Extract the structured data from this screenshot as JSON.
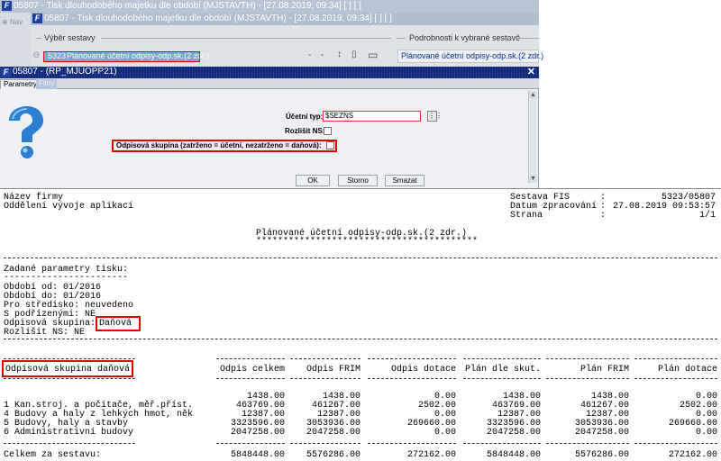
{
  "background": {
    "win1_title": "05807 - Tisk dlouhodobého majetku dle období (MJSTAVTH) - [27.08.2019; 09:34]  [ ]  [ ]",
    "nav_label": "Nav",
    "win2_title": "05807 - Tisk dlouhodobého majetku dle období (MJSTAVTH) - [27.08.2019; 09:34]  [ ]  [ ]",
    "group_left": "Výběr sestavy",
    "group_right": "Podrobnosti k vybrané sestavě",
    "selected_code": "5323",
    "selected_name": "Plánované účetní odpisy-odp.sk.(2 zdr.)",
    "detail_text": "Plánované účetní odpisy-odp.sk.(2 zdr.)",
    "toolbar_icons": [
      "minus-icon",
      "minus-icon",
      "sort-icon",
      "document-icon",
      "monitor-icon"
    ]
  },
  "dialog": {
    "title": "05807 - (RP_MJUOPP21)",
    "close": "✕",
    "tabs": [
      "Parametry",
      "Filtry"
    ],
    "ucetni_typ_label": "Účetní typ:",
    "ucetni_typ_value": "$SEZNS",
    "rozlisit_ns_label": "Rozlišit NS:",
    "odpisova_label": "Odpisová skupina (zatrženo = účetní, nezatrženo = daňová):",
    "buttons": {
      "ok": "OK",
      "storno": "Storno",
      "smazat": "Smazat"
    }
  },
  "report": {
    "company": "Název firmy",
    "department": "Oddělení vývoje aplikací",
    "meta_labels": [
      "Sestava FIS",
      "Datum zpracování",
      "Strana"
    ],
    "meta_values": [
      "5323/05807",
      "27.08.2019 09:53:57",
      "1/1"
    ],
    "title": "Plánované účetní odpisy-odp.sk.(2 zdr.)",
    "title_stars": "*****************************************",
    "params_heading": "Zadané parametry tisku:",
    "params_rule": "-----------------------",
    "params": {
      "obdobi_od": "Období od: 01/2016",
      "obdobi_do": "Období do: 01/2016",
      "stredisko": "Pro středisko: neuvedeno",
      "podrizene": "S podřízenými: NE",
      "skupina_label": "Odpisová skupina:",
      "skupina_value": "Daňová",
      "rozlisit": "Rozlišit NS: NE"
    },
    "columns": [
      "Odpisová skupina daňová",
      "Odpis celkem",
      "Odpis FRIM",
      "Odpis dotace",
      "Plán dle skut.",
      "Plán FRIM",
      "Plán dotace"
    ],
    "rows": [
      {
        "name": "",
        "values": [
          "1438.00",
          "1438.00",
          "0.00",
          "1438.00",
          "1438.00",
          "0.00"
        ]
      },
      {
        "name": "1 Kan.stroj. a počítače, měř.příst.",
        "values": [
          "463769.00",
          "461267.00",
          "2502.00",
          "463769.00",
          "461267.00",
          "2502.00"
        ]
      },
      {
        "name": "4 Budovy a haly z lehkých hmot, něk",
        "values": [
          "12387.00",
          "12387.00",
          "0.00",
          "12387.00",
          "12387.00",
          "0.00"
        ]
      },
      {
        "name": "5 Budovy, haly a stavby",
        "values": [
          "3323596.00",
          "3053936.00",
          "269660.00",
          "3323596.00",
          "3053936.00",
          "269660.00"
        ]
      },
      {
        "name": "6 Administrativní budovy",
        "values": [
          "2047258.00",
          "2047258.00",
          "0.00",
          "2047258.00",
          "2047258.00",
          "0.00"
        ]
      }
    ],
    "total_label": "Celkem za sestavu:",
    "totals": [
      "5848448.00",
      "5576286.00",
      "272162.00",
      "5848448.00",
      "5576286.00",
      "272162.00"
    ]
  }
}
